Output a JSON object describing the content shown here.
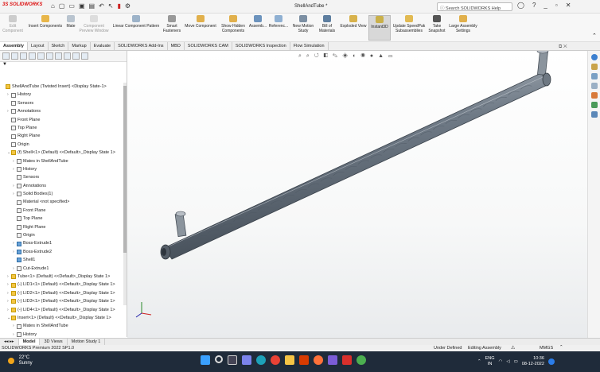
{
  "titlebar": {
    "logo": "3S SOLIDWORKS",
    "document_title": "ShellAndTube *",
    "search_placeholder": "Search SOLIDWORKS Help",
    "quick_access_icons": [
      "home-icon",
      "new-icon",
      "open-icon",
      "save-icon",
      "print-icon",
      "undo-icon",
      "select-icon",
      "rebuild-icon",
      "options-icon"
    ]
  },
  "ribbon": {
    "buttons": [
      {
        "label": "Edit Component",
        "disabled": true
      },
      {
        "label": "Insert Components",
        "disabled": false
      },
      {
        "label": "Mate",
        "disabled": false
      },
      {
        "label": "Component Preview Window",
        "disabled": true
      },
      {
        "label": "Linear Component Pattern",
        "disabled": false
      },
      {
        "label": "Smart Fasteners",
        "disabled": false
      },
      {
        "label": "Move Component",
        "disabled": false
      },
      {
        "label": "Show Hidden Components",
        "disabled": false
      },
      {
        "label": "Assemb...",
        "disabled": false
      },
      {
        "label": "Referenc...",
        "disabled": false
      },
      {
        "label": "New Motion Study",
        "disabled": false
      },
      {
        "label": "Bill of Materials",
        "disabled": false
      },
      {
        "label": "Exploded View",
        "disabled": false
      },
      {
        "label": "Instant3D",
        "disabled": false,
        "active": true
      },
      {
        "label": "Update SpeedPak Subassemblies",
        "disabled": false
      },
      {
        "label": "Take Snapshot",
        "disabled": false
      },
      {
        "label": "Large Assembly Settings",
        "disabled": false
      }
    ]
  },
  "command_tabs": [
    "Assembly",
    "Layout",
    "Sketch",
    "Markup",
    "Evaluate",
    "SOLIDWORKS Add-Ins",
    "MBD",
    "SOLIDWORKS CAM",
    "SOLIDWORKS Inspection",
    "Flow Simulation"
  ],
  "feature_tree": {
    "filter_icon": "filter-icon",
    "rows": [
      {
        "indent": 0,
        "arrow": "",
        "icon": "y",
        "label": "ShellAndTube (Twisted Insert) <Display State-1>"
      },
      {
        "indent": 1,
        "arrow": "›",
        "icon": "",
        "label": "History"
      },
      {
        "indent": 1,
        "arrow": "",
        "icon": "",
        "label": "Sensors"
      },
      {
        "indent": 1,
        "arrow": "›",
        "icon": "",
        "label": "Annotations"
      },
      {
        "indent": 1,
        "arrow": "",
        "icon": "",
        "label": "Front Plane"
      },
      {
        "indent": 1,
        "arrow": "",
        "icon": "",
        "label": "Top Plane"
      },
      {
        "indent": 1,
        "arrow": "",
        "icon": "",
        "label": "Right Plane"
      },
      {
        "indent": 1,
        "arrow": "",
        "icon": "",
        "label": "Origin"
      },
      {
        "indent": 1,
        "arrow": "⌄",
        "icon": "y",
        "label": "(f) Shell<1> (Default) <<Default>_Display State 1>"
      },
      {
        "indent": 2,
        "arrow": "›",
        "icon": "",
        "label": "Mates in ShellAndTube"
      },
      {
        "indent": 2,
        "arrow": "›",
        "icon": "",
        "label": "History"
      },
      {
        "indent": 2,
        "arrow": "",
        "icon": "",
        "label": "Sensors"
      },
      {
        "indent": 2,
        "arrow": "›",
        "icon": "",
        "label": "Annotations"
      },
      {
        "indent": 2,
        "arrow": "›",
        "icon": "",
        "label": "Solid Bodies(1)"
      },
      {
        "indent": 2,
        "arrow": "",
        "icon": "",
        "label": "Material <not specified>"
      },
      {
        "indent": 2,
        "arrow": "",
        "icon": "",
        "label": "Front Plane"
      },
      {
        "indent": 2,
        "arrow": "",
        "icon": "",
        "label": "Top Plane"
      },
      {
        "indent": 2,
        "arrow": "",
        "icon": "",
        "label": "Right Plane"
      },
      {
        "indent": 2,
        "arrow": "",
        "icon": "",
        "label": "Origin"
      },
      {
        "indent": 2,
        "arrow": "›",
        "icon": "b",
        "label": "Boss-Extrude1"
      },
      {
        "indent": 2,
        "arrow": "›",
        "icon": "b",
        "label": "Boss-Extrude2"
      },
      {
        "indent": 2,
        "arrow": "",
        "icon": "b",
        "label": "Shell1"
      },
      {
        "indent": 2,
        "arrow": "›",
        "icon": "",
        "label": "Cut-Extrude1"
      },
      {
        "indent": 1,
        "arrow": "›",
        "icon": "y",
        "label": "Tube<1> (Default) <<Default>_Display State 1>"
      },
      {
        "indent": 1,
        "arrow": "›",
        "icon": "y",
        "label": "(-) LID1<1> (Default) <<Default>_Display State 1>"
      },
      {
        "indent": 1,
        "arrow": "›",
        "icon": "y",
        "label": "(-) LID2<1> (Default) <<Default>_Display State 1>"
      },
      {
        "indent": 1,
        "arrow": "›",
        "icon": "y",
        "label": "(-) LID3<1> (Default) <<Default>_Display State 1>"
      },
      {
        "indent": 1,
        "arrow": "›",
        "icon": "y",
        "label": "(-) LID4<1> (Default) <<Default>_Display State 1>"
      },
      {
        "indent": 1,
        "arrow": "⌄",
        "icon": "y",
        "label": "Insert<1> (Default) <<Default>_Display State 1>"
      },
      {
        "indent": 2,
        "arrow": "›",
        "icon": "",
        "label": "Mates in ShellAndTube"
      },
      {
        "indent": 2,
        "arrow": "›",
        "icon": "",
        "label": "History"
      }
    ]
  },
  "bottom_tabs": [
    "Model",
    "3D Views",
    "Motion Study 1"
  ],
  "status": {
    "left": "SOLIDWORKS Premium 2022 SP1.0",
    "state": "Under Defined",
    "mode": "Editing Assembly",
    "units": "MMGS"
  },
  "taskbar": {
    "temperature": "22°C",
    "weather": "Sunny",
    "lang_top": "ENG",
    "lang_bottom": "IN",
    "time": "10:36",
    "date": "08-12-2022"
  },
  "colors": {
    "taskbar_bg": "#1f2b3a",
    "tube_fill": "#6f7a86",
    "accent_red": "#d11"
  }
}
